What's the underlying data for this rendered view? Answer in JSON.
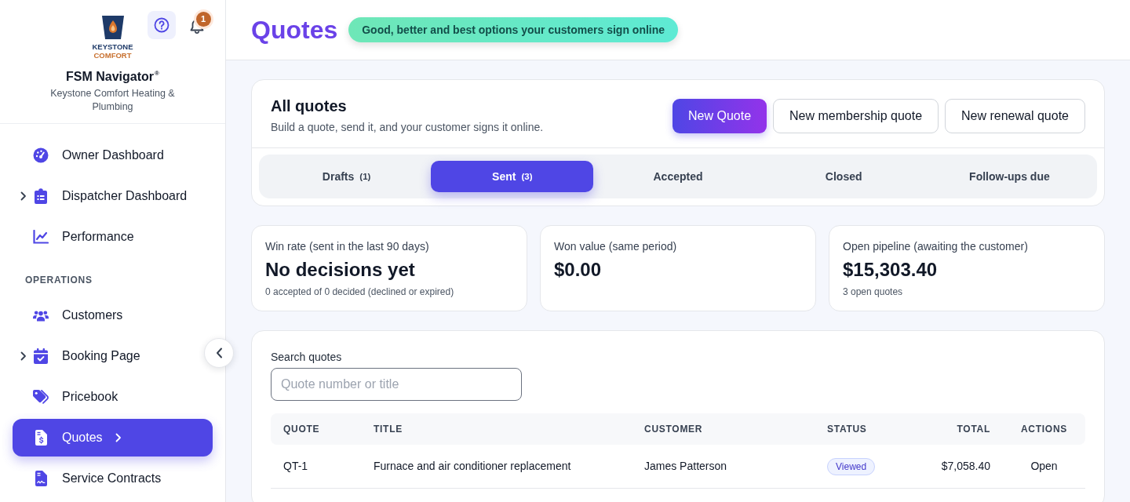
{
  "sidebar": {
    "logo": {
      "line_1": "KEYSTONE",
      "line_2": "COMFORT"
    },
    "notifications": {
      "count": "1"
    },
    "app_name": "FSM Navigator$^{®}$",
    "company": "Keystone Comfort Heating & Plumbing",
    "sections": [
      {
        "items": [
          {
            "label": "Owner Dashboard",
            "selected": false
          },
          {
            "label": "Dispatcher Dashboard",
            "selected": false,
            "expanded": false
          },
          {
            "label": "Performance",
            "selected": false
          }
        ]
      },
      {
        "title": "OPERATIONS",
        "items": [
          {
            "label": "Customers",
            "selected": false
          },
          {
            "label": "Booking Page",
            "selected": false,
            "expanded": false
          },
          {
            "label": "Pricebook",
            "selected": false
          },
          {
            "label": "Quotes",
            "selected": true
          },
          {
            "label": "Service Contracts",
            "selected": false
          }
        ]
      }
    ]
  },
  "header": {
    "title": "Quotes",
    "tagline": "Good, better and best options your customers sign online"
  },
  "quotes_panel": {
    "title": "All quotes",
    "subtitle": "Build a quote, send it, and your customer signs it online.",
    "buttons": [
      {
        "label": "New Quote",
        "kind": "primary"
      },
      {
        "label": "New membership quote",
        "kind": "secondary"
      },
      {
        "label": "New renewal quote",
        "kind": "secondary"
      }
    ],
    "tabs": [
      {
        "label": "Drafts",
        "count": "(1)",
        "selected": false
      },
      {
        "label": "Sent",
        "count": "(3)",
        "selected": true
      },
      {
        "label": "Accepted",
        "selected": false
      },
      {
        "label": "Closed",
        "selected": false
      },
      {
        "label": "Follow-ups due",
        "selected": false
      }
    ]
  },
  "stats": [
    {
      "label": "Win rate (sent in the last 90 days)",
      "value": "No decisions yet",
      "note": "0 accepted of 0 decided (declined or expired)"
    },
    {
      "label": "Won value (same period)",
      "value": "$0.00"
    },
    {
      "label": "Open pipeline (awaiting the customer)",
      "value": "$15,303.40",
      "note": "3 open quotes"
    }
  ],
  "quotes_table": {
    "search": {
      "label": "Search quotes",
      "placeholder": "Quote number or title"
    },
    "columns": [
      "QUOTE",
      "TITLE",
      "CUSTOMER",
      "STATUS",
      "TOTAL",
      "ACTIONS"
    ],
    "rows": [
      {
        "cells": [
          "QT-1",
          "Furnace and air conditioner replacement",
          "James Patterson",
          "Viewed",
          "$7,058.40",
          "Open"
        ]
      }
    ]
  }
}
